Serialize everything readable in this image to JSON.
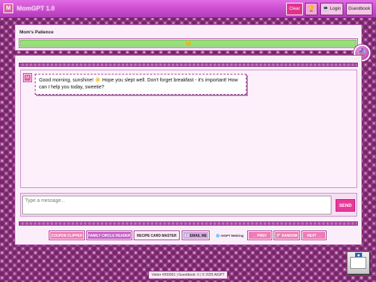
{
  "app": {
    "icon_letter": "M",
    "title": "MomGPT 1.0"
  },
  "toolbar": {
    "clear_label": "Clear",
    "trophy_icon": "trophy-icon",
    "login_label": "💻 Login",
    "guestbook_label": "Guestbook"
  },
  "patience": {
    "label": "Mom's Patience",
    "level_percent": 100,
    "emoji": "😊"
  },
  "fab_icon": "🔮",
  "chat": {
    "messages": [
      {
        "avatar": "M",
        "text": "Good morning, sunshine! ☀️ Hope you slept well. Don't forget breakfast - it's important! How can I help you today, sweetie?"
      }
    ]
  },
  "input": {
    "placeholder": "Type a message...",
    "send_label": "SEND"
  },
  "nav": {
    "coupon": "COUPON CLIPPER",
    "family": "FAMILY CIRCLE READER",
    "recipe": "RECIPE CARD MASTER",
    "email": "📧 EMAIL ME",
    "webring": "🌐 AIGPT Webring",
    "prev": "← PREV",
    "random": "🎲 RANDOM",
    "next": "NEXT →"
  },
  "footer": {
    "text": "Visitor #000001 | Guestbook: 0 | © 2025 AIGPT"
  },
  "colors": {
    "titlebar": "#c94ccf",
    "accent": "#e93a9a",
    "patience_fill": "#9ae07a",
    "background": "#9a3f8a"
  }
}
